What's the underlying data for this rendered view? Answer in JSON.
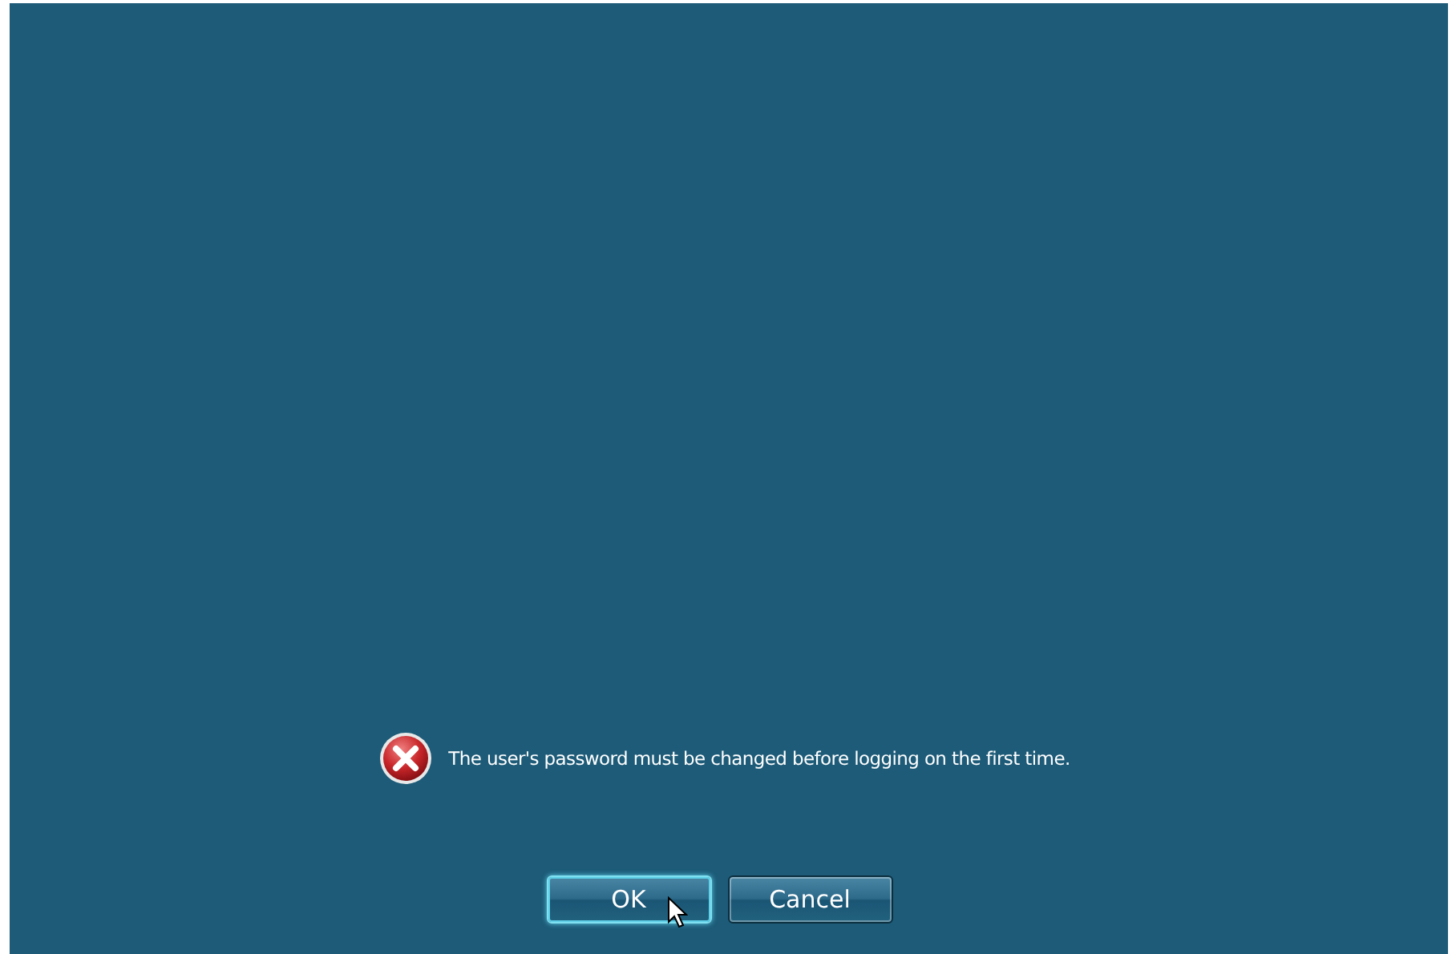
{
  "message": {
    "kind": "error",
    "text": "The user's password must be changed before logging on the first time."
  },
  "buttons": [
    {
      "label": "OK",
      "selected": true
    },
    {
      "label": "Cancel",
      "selected": false
    }
  ]
}
